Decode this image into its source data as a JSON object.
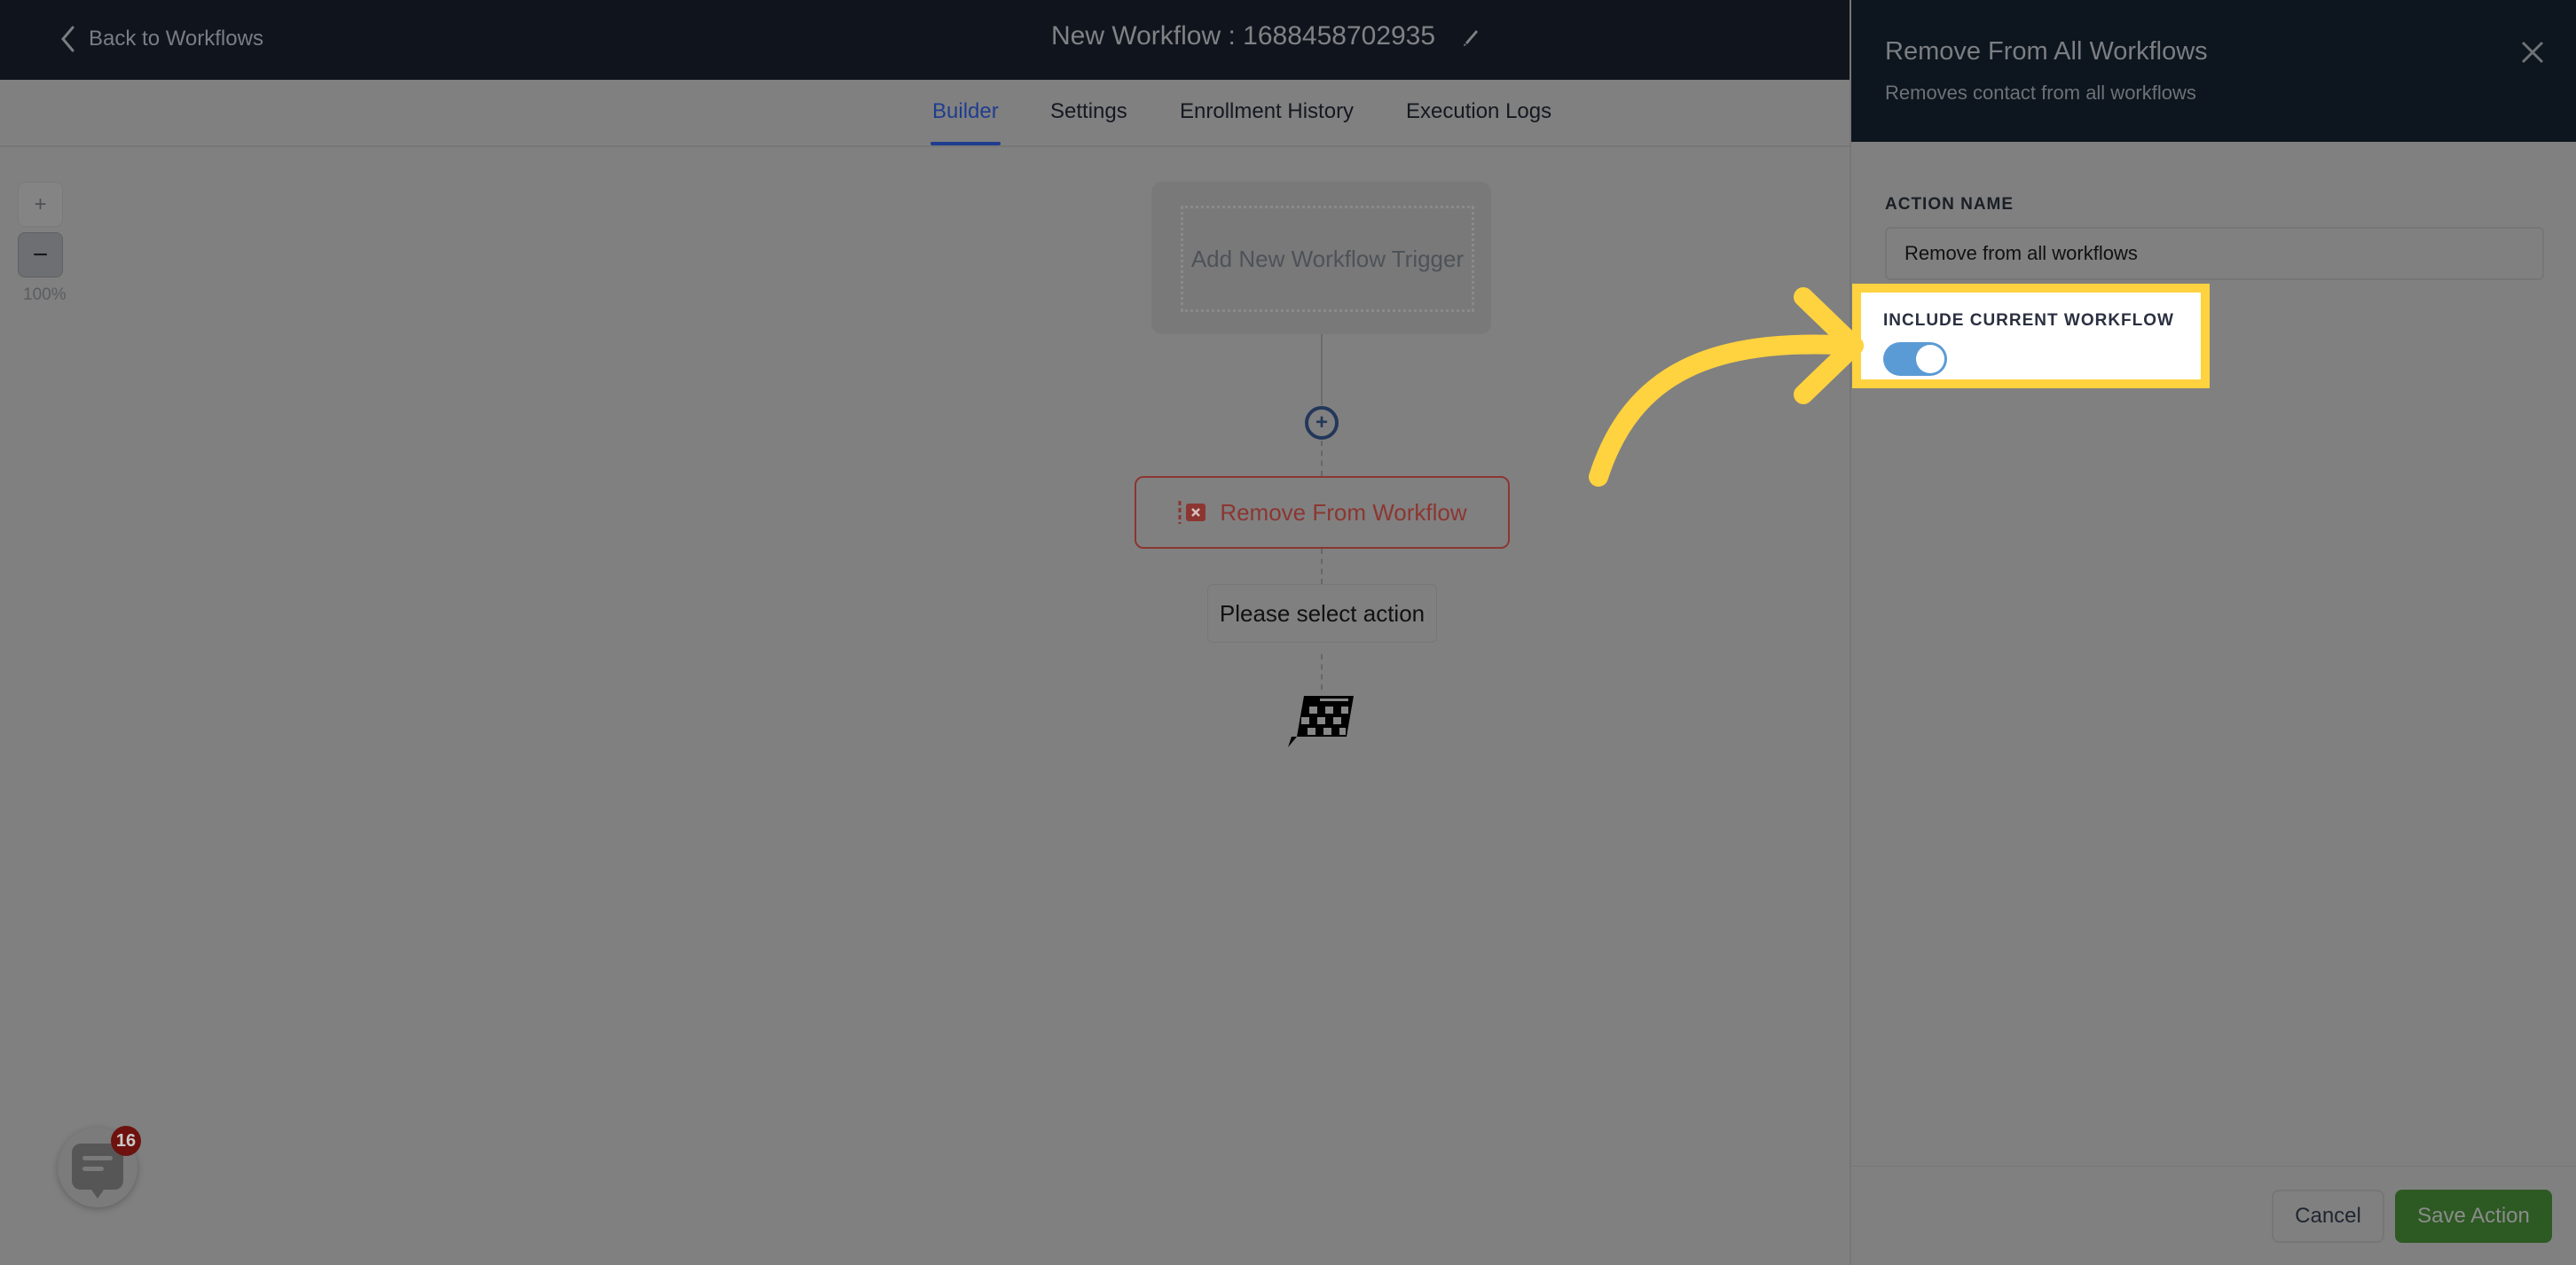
{
  "header": {
    "back_label": "Back to Workflows",
    "workflow_title": "New Workflow : 1688458702935"
  },
  "tabs": [
    {
      "label": "Builder",
      "active": true
    },
    {
      "label": "Settings",
      "active": false
    },
    {
      "label": "Enrollment History",
      "active": false
    },
    {
      "label": "Execution Logs",
      "active": false
    }
  ],
  "zoom": {
    "in_symbol": "+",
    "out_symbol": "−",
    "level": "100%"
  },
  "canvas": {
    "trigger_label": "Add New Workflow Trigger",
    "add_step_symbol": "+",
    "action_node_label": "Remove From Workflow",
    "select_action_label": "Please select action"
  },
  "chat": {
    "badge_count": "16"
  },
  "panel": {
    "title": "Remove From All Workflows",
    "subtitle": "Removes contact from all workflows",
    "action_name_label": "ACTION NAME",
    "action_name_value": "Remove from all workflows",
    "include_current_label": "INCLUDE CURRENT WORKFLOW",
    "include_current_enabled": true,
    "cancel_label": "Cancel",
    "save_label": "Save Action"
  },
  "colors": {
    "accent_tab": "#1f3d8f",
    "action_red": "#8c3631",
    "toggle_on": "#5b9bd5",
    "save_green": "#2d5923",
    "annotation_yellow": "#ffd23f",
    "badge_red": "#6d120e"
  }
}
